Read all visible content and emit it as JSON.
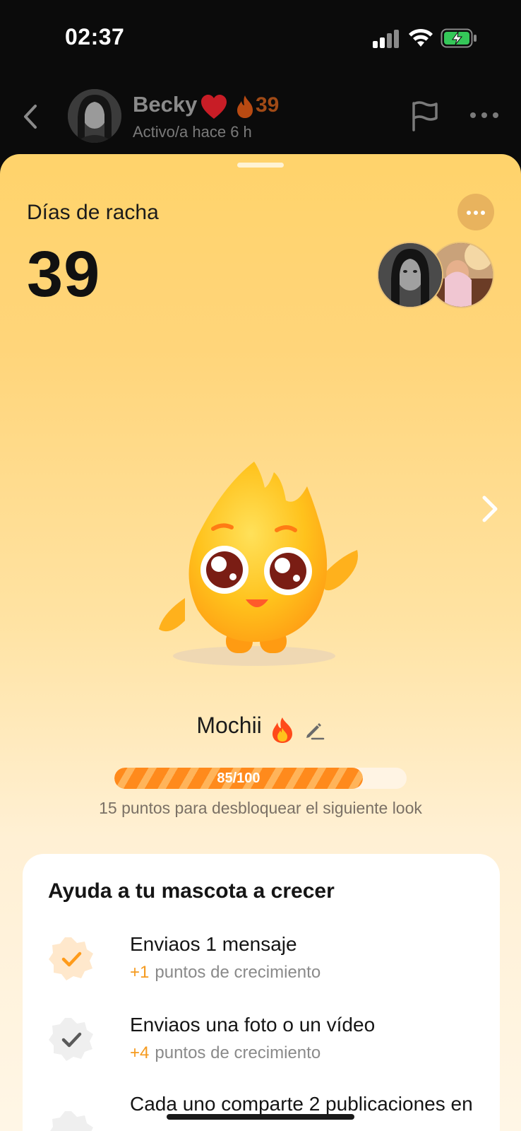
{
  "status_bar": {
    "time": "02:37",
    "signal_icon": "cellular-signal-icon",
    "wifi_icon": "wifi-icon",
    "battery_icon": "battery-charging-icon"
  },
  "chat_header": {
    "name": "Becky",
    "heart_icon": "heart-icon",
    "streak_count": "39",
    "activity": "Activo/a hace 6 h"
  },
  "sheet": {
    "title": "Días de racha",
    "streak_days": "39",
    "pet_name": "Mochii",
    "progress": {
      "current": 85,
      "max": 100,
      "label": "85/100"
    },
    "progress_hint": "15 puntos para desbloquear el siguiente look"
  },
  "tasks_card": {
    "title": "Ayuda a tu mascota a crecer",
    "tasks": [
      {
        "title": "Enviaos 1 mensaje",
        "points": "+1",
        "points_label": "puntos de crecimiento",
        "done": true
      },
      {
        "title": "Enviaos una foto o un vídeo",
        "points": "+4",
        "points_label": "puntos de crecimiento",
        "done": false
      },
      {
        "title": "Cada uno comparte 2 publicaciones en",
        "points": "",
        "points_label": "",
        "done": false
      }
    ]
  },
  "colors": {
    "accent": "#ff8a1c",
    "sheet_top": "#ffd36b",
    "muted": "#8a8a8a"
  }
}
